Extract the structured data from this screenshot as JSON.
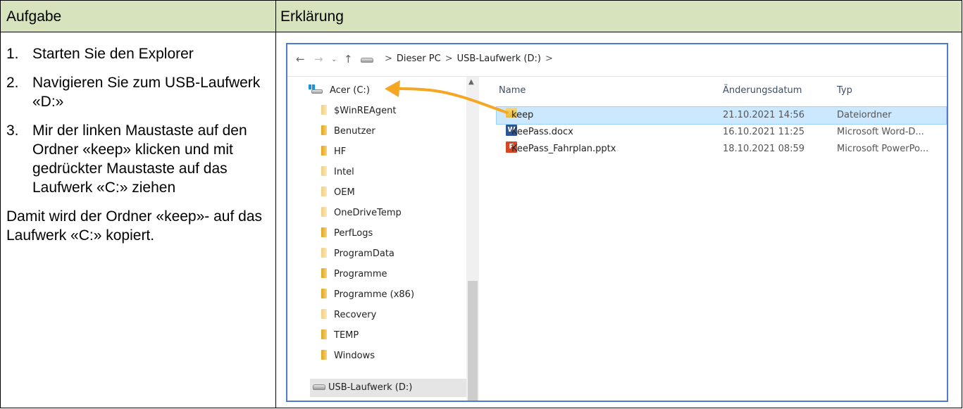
{
  "table": {
    "header_left": "Aufgabe",
    "header_right": "Erklärung",
    "header_color": "#d6e3bc"
  },
  "instructions": {
    "steps": [
      {
        "num": "1.",
        "text": "Starten Sie den Explorer"
      },
      {
        "num": "2.",
        "text": "Navigieren Sie zum USB-Laufwerk «D:»"
      },
      {
        "num": "3.",
        "text": "Mir der linken Maustaste auf den Ordner «keep» klicken und mit gedrückter Maustaste auf das Laufwerk «C:» ziehen"
      }
    ],
    "summary": "Damit wird der Ordner «keep»- auf das Laufwerk «C:» kopiert."
  },
  "explorer": {
    "nav": {
      "back_icon": "arrow-left-icon",
      "forward_icon": "arrow-right-icon",
      "recent_icon": "chevron-down-icon",
      "up_icon": "arrow-up-icon"
    },
    "breadcrumb": [
      "Dieser PC",
      "USB-Laufwerk (D:)"
    ],
    "sidebar": {
      "drive_c": "Acer (C:)",
      "folders": [
        "$WinREAgent",
        "Benutzer",
        "HF",
        "Intel",
        "OEM",
        "OneDriveTemp",
        "PerfLogs",
        "ProgramData",
        "Programme",
        "Programme (x86)",
        "Recovery",
        "TEMP",
        "Windows"
      ],
      "drive_d": "USB-Laufwerk (D:)"
    },
    "columns": {
      "name": "Name",
      "date": "Änderungsdatum",
      "type": "Typ"
    },
    "files": [
      {
        "name": "keep",
        "date": "21.10.2021 14:56",
        "type": "Dateiordner",
        "icon": "folder-icon",
        "selected": true
      },
      {
        "name": "KeePass.docx",
        "date": "16.10.2021 11:25",
        "type": "Microsoft Word-D...",
        "icon": "word-document-icon",
        "selected": false
      },
      {
        "name": "KeePass_Fahrplan.pptx",
        "date": "18.10.2021 08:59",
        "type": "Microsoft PowerPo...",
        "icon": "powerpoint-icon",
        "selected": false
      }
    ],
    "drag_arrow_color": "#f5a623"
  }
}
